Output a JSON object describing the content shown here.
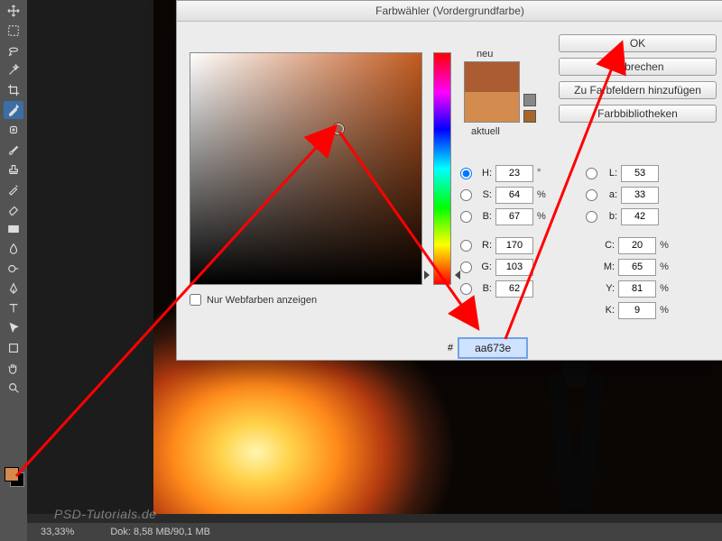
{
  "dialog": {
    "title": "Farbwähler (Vordergrundfarbe)",
    "buttons": {
      "ok": "OK",
      "cancel": "Abbrechen",
      "add": "Zu Farbfeldern hinzufügen",
      "libs": "Farbbibliotheken"
    },
    "labels": {
      "neu": "neu",
      "aktuell": "aktuell",
      "webonly": "Nur Webfarben anzeigen"
    }
  },
  "color": {
    "hex": "aa673e",
    "H": "23",
    "Hu": "°",
    "S": "64",
    "B": "67",
    "R": "170",
    "G": "103",
    "Bb": "62",
    "L": "53",
    "a": "33",
    "bb": "42",
    "C": "20",
    "M": "65",
    "Y": "81",
    "K": "9",
    "pct": "%"
  },
  "status": {
    "zoom": "33,33%",
    "doc": "Dok: 8,58 MB/90,1 MB"
  },
  "watermark": "PSD-Tutorials.de"
}
